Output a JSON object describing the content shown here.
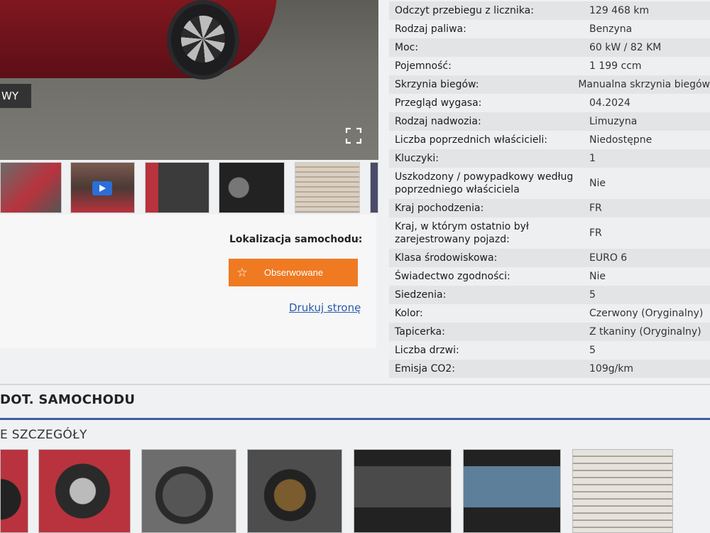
{
  "gallery_top": {
    "photo_label": "WY",
    "thumbnails": [
      {
        "name": "car-front-thumb",
        "color": "#b8333d"
      },
      {
        "name": "engine-video-thumb",
        "color": "#6b4440"
      },
      {
        "name": "interior-thumb",
        "color": "#4a4a4a"
      },
      {
        "name": "dashboard-thumb",
        "color": "#333"
      },
      {
        "name": "document-thumb",
        "color": "#c9b9a8"
      }
    ]
  },
  "location": {
    "label": "Lokalizacja samochodu:",
    "value": "-"
  },
  "actions": {
    "watch_label": "Obserwowane",
    "print_label": "Drukuj stronę"
  },
  "specs": [
    {
      "key": "Odczyt przebiegu z licznika:",
      "value": "129 468 km"
    },
    {
      "key": "Rodzaj paliwa:",
      "value": "Benzyna"
    },
    {
      "key": "Moc:",
      "value": "60 kW / 82 KM"
    },
    {
      "key": "Pojemność:",
      "value": "1 199 ccm"
    },
    {
      "key": "Skrzynia biegów:",
      "value": "Manualna skrzynia biegów"
    },
    {
      "key": "Przegląd wygasa:",
      "value": "04.2024"
    },
    {
      "key": "Rodzaj nadwozia:",
      "value": "Limuzyna"
    },
    {
      "key": "Liczba poprzednich właścicieli:",
      "value": "Niedostępne"
    },
    {
      "key": "Kluczyki:",
      "value": "1"
    },
    {
      "key": "Uszkodzony / powypadkowy według poprzedniego właściciela",
      "value": "Nie"
    },
    {
      "key": "Kraj pochodzenia:",
      "value": "FR"
    },
    {
      "key": "Kraj, w którym ostatnio był zarejestrowany pojazd:",
      "value": "FR"
    },
    {
      "key": "Klasa środowiskowa:",
      "value": "EURO 6"
    },
    {
      "key": "Świadectwo zgodności:",
      "value": "Nie"
    },
    {
      "key": "Siedzenia:",
      "value": "5"
    },
    {
      "key": "Kolor:",
      "value": "Czerwony (Oryginalny)"
    },
    {
      "key": "Tapicerka:",
      "value": "Z tkaniny (Oryginalny)"
    },
    {
      "key": "Liczba drzwi:",
      "value": "5"
    },
    {
      "key": "Emisja CO2:",
      "value": "109g/km"
    }
  ],
  "section": {
    "title": "DOT. SAMOCHODU",
    "subtitle": "E SZCZEGÓŁY"
  },
  "colors": {
    "accent": "#ef7a22",
    "link": "#2a5aa8",
    "divider": "#3f5fa6"
  }
}
